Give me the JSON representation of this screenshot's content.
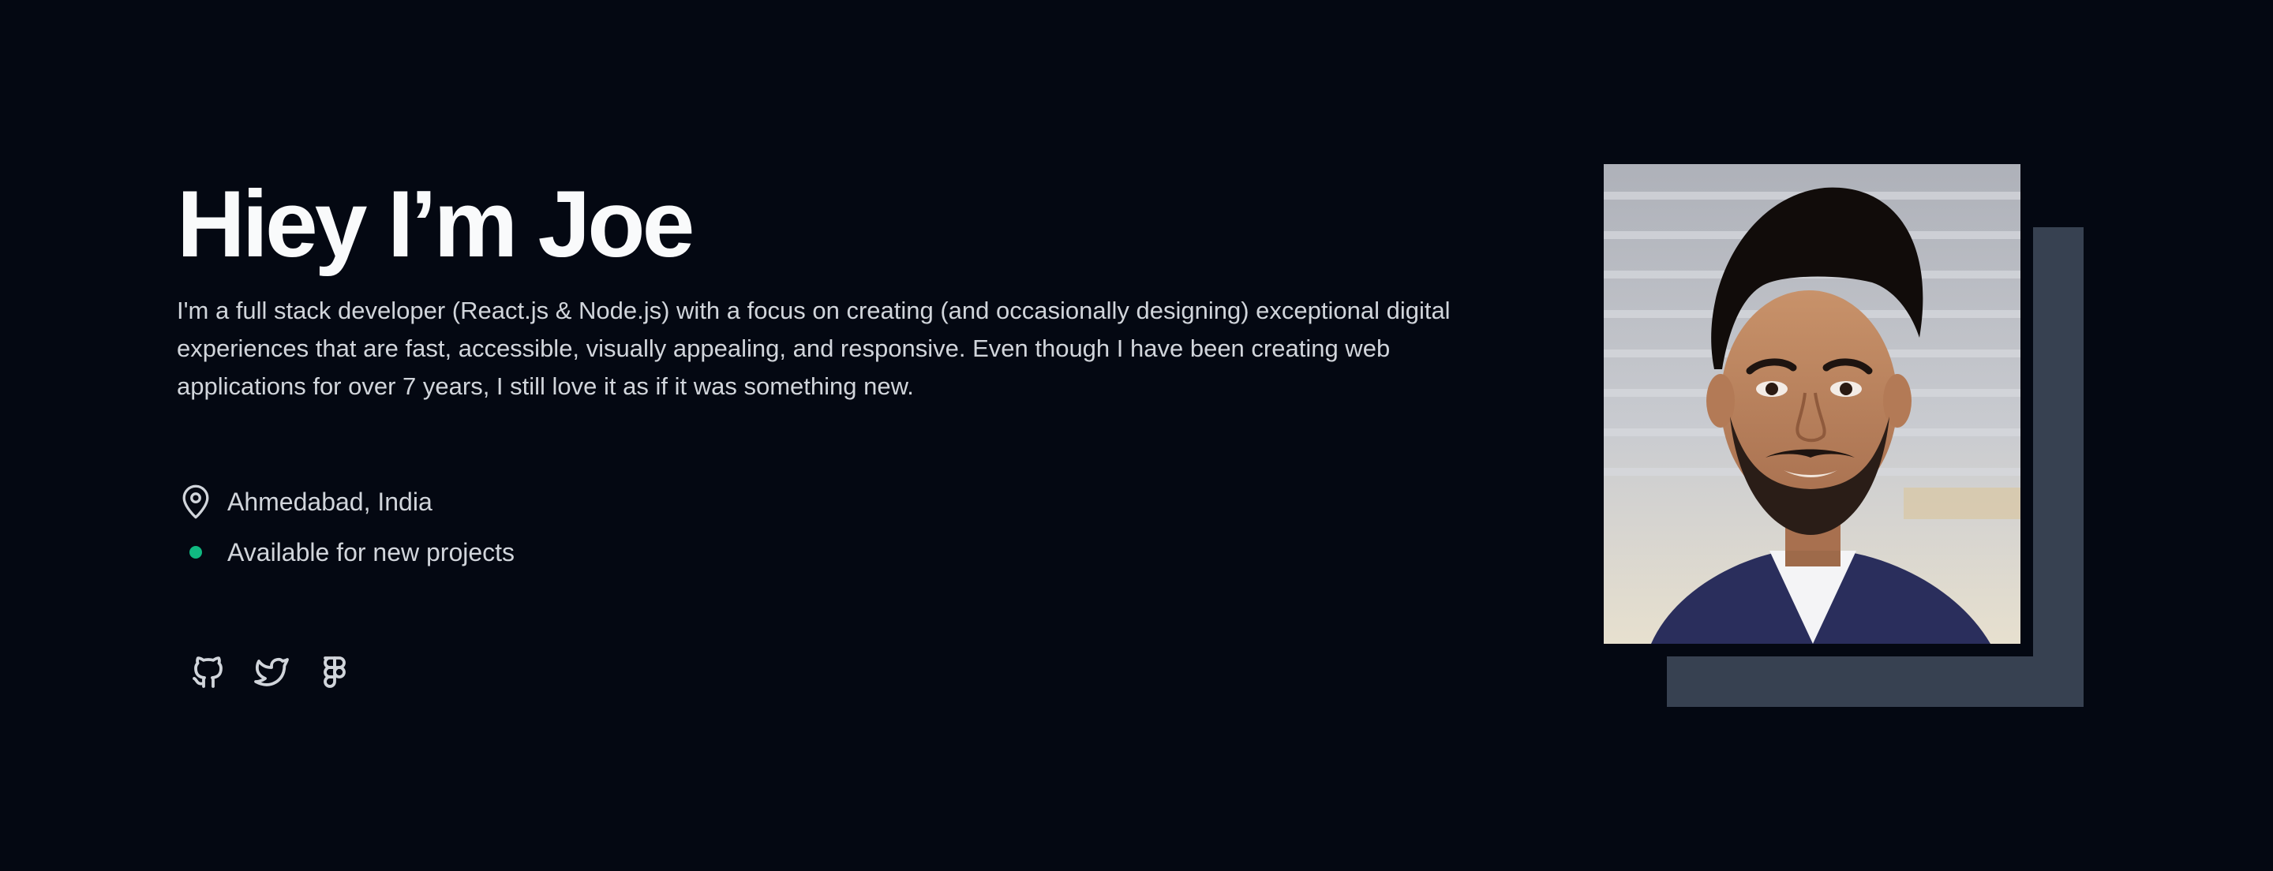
{
  "hero": {
    "title": "Hiey I’m Joe",
    "bio": "I'm a full stack developer (React.js & Node.js) with a focus on creating (and occasionally designing) exceptional digital experiences that are fast, accessible, visually appealing, and responsive. Even though I have been creating web applications for over 7 years, I still love it as if it was something new.",
    "location": "Ahmedabad, India",
    "availability": "Available for new projects",
    "availability_color": "#10b981",
    "social": [
      {
        "icon": "github-icon"
      },
      {
        "icon": "twitter-icon"
      },
      {
        "icon": "figma-icon"
      }
    ],
    "photo": {
      "icon": "profile-photo"
    }
  },
  "colors": {
    "background": "#040812",
    "title": "#f9fafb",
    "text": "#d1d5db",
    "accent_block": "#374151"
  }
}
